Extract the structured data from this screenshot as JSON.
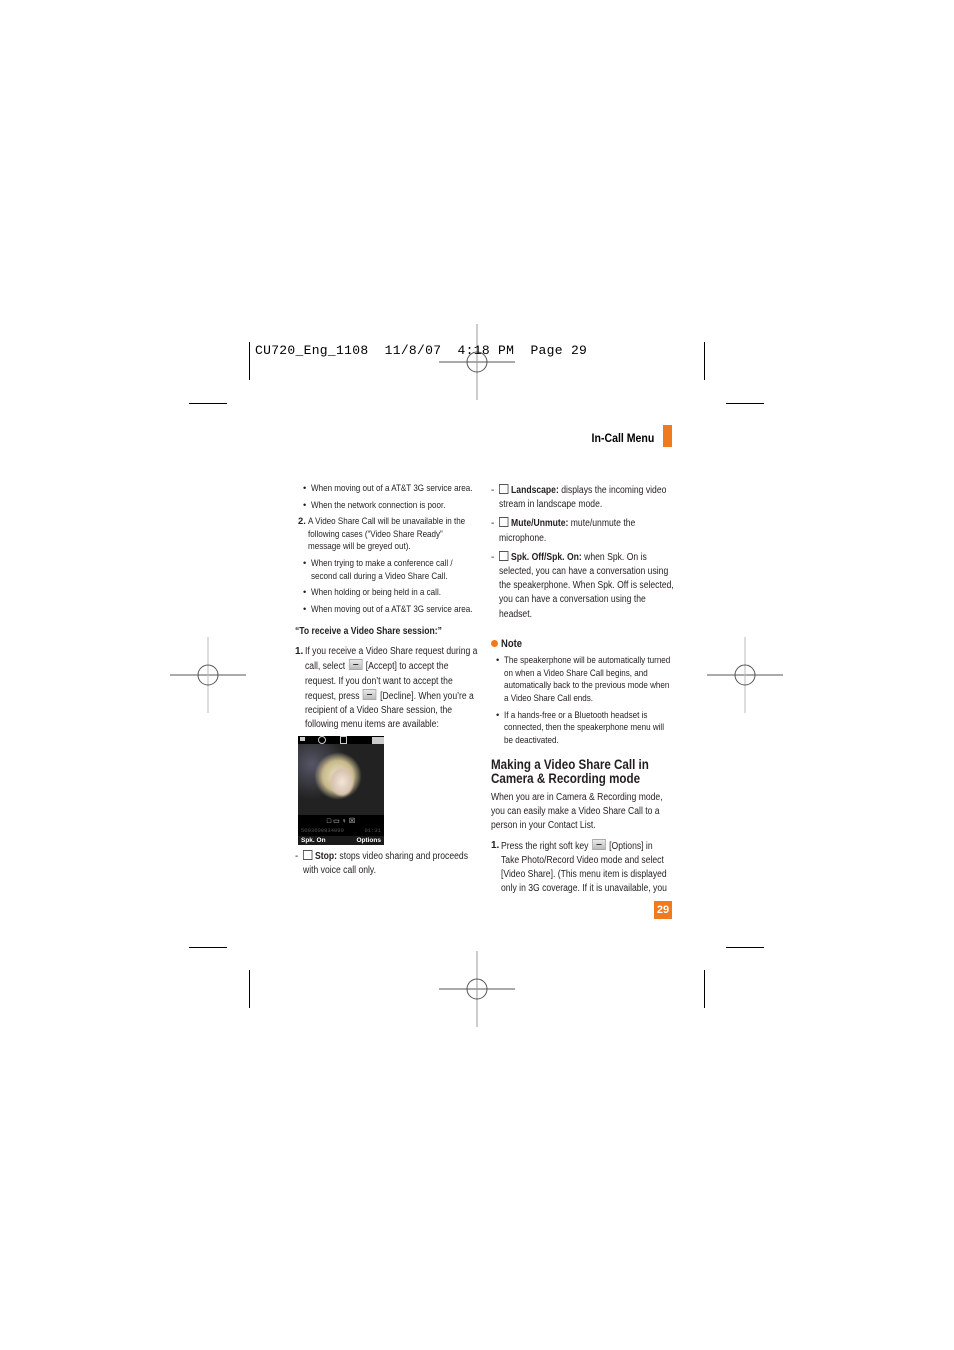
{
  "slug": {
    "text": "CU720_Eng_1108  11/8/07  4:18 PM  Page 29"
  },
  "header": {
    "section_title": "In-Call Menu",
    "accent_color": "#f07a1f"
  },
  "left_column": {
    "bullets_top": [
      "When moving out of a AT&T 3G service area.",
      "When the network connection is poor."
    ],
    "item2": {
      "number": "2.",
      "lines": [
        "A Video Share Call will be unavailable in the",
        "following cases (“Video Share Ready”",
        "message will be greyed out)."
      ]
    },
    "bullets_cases": [
      [
        "When trying to make a conference call /",
        "second call during a Video Share Call."
      ],
      [
        "When holding or being held in a call."
      ],
      [
        "When moving out of a AT&T 3G service area."
      ]
    ],
    "receive_heading": "“To receive a Video Share session:”",
    "item1": {
      "number": "1.",
      "line1": "If you receive a Video Share request during a",
      "line2_pre": "call, select",
      "line2_post": "[Accept] to accept the",
      "line3": "request. If you don’t want to accept the",
      "line4_pre": "request, press",
      "line4_post": "[Decline]. When you’re a",
      "line5": "recipient of a Video Share session, the",
      "line6": "following menu items are available:"
    },
    "phone_screen": {
      "phone_number": "5093600934090",
      "call_timer": "01:31",
      "left_softkey": "Spk. On",
      "right_softkey": "Options",
      "icons": "□ ▭ ♀ ☒"
    },
    "stop_item": {
      "label": "Stop:",
      "line1": "stops video sharing and proceeds",
      "line2": "with voice call only."
    }
  },
  "right_column": {
    "menu_items": [
      {
        "icon": "landscape-icon",
        "label": "Landscape:",
        "lines": [
          "displays the incoming video",
          "stream in landscape mode."
        ]
      },
      {
        "icon": "mute-icon",
        "label": "Mute/Unmute:",
        "lines": [
          "mute/unmute the",
          "microphone."
        ]
      },
      {
        "icon": "speaker-icon",
        "label": "Spk. Off/Spk. On:",
        "lines": [
          "when Spk. On is",
          "selected, you can have a conversation using",
          "the speakerphone. When Spk. Off is selected,",
          "you can have a conversation using the",
          "headset."
        ]
      }
    ],
    "note": {
      "title": "Note",
      "bullets": [
        [
          "The speakerphone will be automatically turned",
          "on when a Video Share Call begins, and",
          "automatically back to the previous mode when",
          "a Video Share Call ends."
        ],
        [
          "If a hands-free or a Bluetooth headset is",
          "connected, then the speakerphone menu will",
          "be deactivated."
        ]
      ]
    },
    "section_heading": [
      "Making a Video Share Call in",
      "Camera & Recording mode"
    ],
    "intro": [
      "When you are in Camera & Recording mode,",
      "you can easily make a Video Share Call to a",
      "person in your Contact List."
    ],
    "step1": {
      "number": "1.",
      "line1_pre": "Press the right soft key",
      "line1_post": "[Options] in",
      "line2": "Take Photo/Record Video mode and select",
      "line3": "[Video Share]. (This menu item is displayed",
      "line4": "only in 3G coverage. If it is unavailable, you"
    }
  },
  "page_number": "29"
}
